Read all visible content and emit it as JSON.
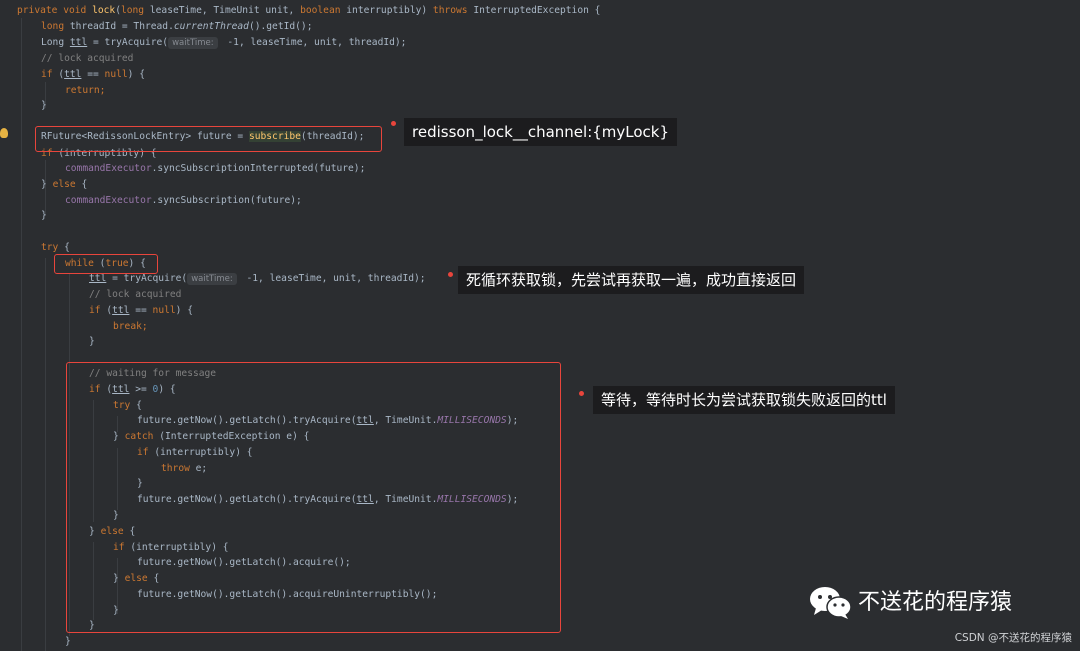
{
  "code": {
    "l1": {
      "a": "private void ",
      "b": "lock",
      "c": "(",
      "d": "long ",
      "e": "leaseTime, TimeUnit unit, ",
      "f": "boolean ",
      "g": "interruptibly) ",
      "h": "throws ",
      "i": "InterruptedException {"
    },
    "l2": {
      "a": "long ",
      "b": "threadId = Thread.",
      "c": "currentThread",
      "d": "().getId();"
    },
    "l3": {
      "a": "Long ",
      "b": "ttl",
      "c": " = tryAcquire(",
      "hint": "waitTime:",
      "d": " -1, leaseTime, unit, threadId);"
    },
    "l4": {
      "a": "// lock acquired"
    },
    "l5": {
      "a": "if ",
      "b": "(",
      "c": "ttl",
      "d": " == ",
      "e": "null",
      "f": ") {"
    },
    "l6": {
      "a": "return;"
    },
    "l7": {
      "a": "}"
    },
    "l8": {
      "a": "RFuture<RedissonLockEntry> future = ",
      "b": "subscribe",
      "c": "(threadId);"
    },
    "l9": {
      "a": "if ",
      "b": "(interruptibly) {"
    },
    "l10": {
      "a": "commandExecutor",
      "b": ".syncSubscriptionInterrupted(future);"
    },
    "l11": {
      "a": "} ",
      "b": "else ",
      "c": "{"
    },
    "l12": {
      "a": "commandExecutor",
      "b": ".syncSubscription(future);"
    },
    "l13": {
      "a": "}"
    },
    "l14": {
      "a": "try ",
      "b": "{"
    },
    "l15": {
      "a": "while ",
      "b": "(",
      "c": "true",
      "d": ") {"
    },
    "l16": {
      "a": "ttl",
      "b": " = tryAcquire(",
      "hint": "waitTime:",
      "c": " -1, leaseTime, unit, threadId);"
    },
    "l17": {
      "a": "// lock acquired"
    },
    "l18": {
      "a": "if ",
      "b": "(",
      "c": "ttl",
      "d": " == ",
      "e": "null",
      "f": ") {"
    },
    "l19": {
      "a": "break;"
    },
    "l20": {
      "a": "}"
    },
    "l21": {
      "a": "// waiting for message"
    },
    "l22": {
      "a": "if ",
      "b": "(",
      "c": "ttl",
      "d": " >= ",
      "e": "0",
      "f": ") {"
    },
    "l23": {
      "a": "try ",
      "b": "{"
    },
    "l24": {
      "a": "future.getNow().getLatch().tryAcquire(",
      "b": "ttl",
      "c": ", TimeUnit.",
      "d": "MILLISECONDS",
      "e": ");"
    },
    "l25": {
      "a": "} ",
      "b": "catch ",
      "c": "(InterruptedException e) {"
    },
    "l26": {
      "a": "if ",
      "b": "(interruptibly) {"
    },
    "l27": {
      "a": "throw ",
      "b": "e;"
    },
    "l28": {
      "a": "}"
    },
    "l29": {
      "a": "future.getNow().getLatch().tryAcquire(",
      "b": "ttl",
      "c": ", TimeUnit.",
      "d": "MILLISECONDS",
      "e": ");"
    },
    "l30": {
      "a": "}"
    },
    "l31": {
      "a": "} ",
      "b": "else ",
      "c": "{"
    },
    "l32": {
      "a": "if ",
      "b": "(interruptibly) {"
    },
    "l33": {
      "a": "future.getNow().getLatch().acquire();"
    },
    "l34": {
      "a": "} ",
      "b": "else ",
      "c": "{"
    },
    "l35": {
      "a": "future.getNow().getLatch().acquireUninterruptibly();"
    },
    "l36": {
      "a": "}"
    },
    "l37": {
      "a": "}"
    },
    "l38": {
      "a": "}"
    }
  },
  "annotations": {
    "subscribe_note": "redisson_lock__channel:{myLock}",
    "loop_note": "死循环获取锁，先尝试再获取一遍，成功直接返回",
    "wait_note": "等待，等待时长为尝试获取锁失败返回的ttl"
  },
  "watermark": {
    "title": "不送花的程序猿",
    "csdn": "CSDN @不送花的程序猿"
  },
  "colors": {
    "background": "#2b2d30",
    "highlight": "#e8453c",
    "keyword": "#cc7832",
    "method": "#ffc66d",
    "comment": "#808080",
    "field": "#9876aa"
  },
  "icons": {
    "gutter": "lightbulb-icon",
    "watermark": "wechat-icon"
  }
}
